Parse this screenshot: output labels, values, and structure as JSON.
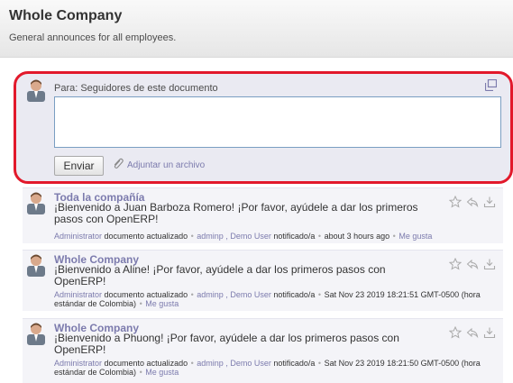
{
  "header": {
    "title": "Whole Company",
    "description": "General announces for all employees."
  },
  "composer": {
    "to_label": "Para: Seguidores de este documento",
    "message_value": "",
    "send_label": "Enviar",
    "attach_label": "Adjuntar un archivo",
    "icons": [
      "avatar",
      "expand-icon",
      "paperclip-icon"
    ]
  },
  "messages": [
    {
      "author": "Toda la compañía",
      "body": "¡Bienvenido a Juan Barboza Romero! ¡Por favor, ayúdele a dar los primeros pasos con OpenERP!",
      "meta": {
        "author": "Administrator",
        "action": "documento actualizado",
        "notified_1": "adminp",
        "notified_2": "Demo User",
        "notified_label": "notificado/a",
        "time": "about 3 hours ago",
        "like": "Me gusta"
      }
    },
    {
      "author": "Whole Company",
      "body": "¡Bienvenido a Aline! ¡Por favor, ayúdele a dar los primeros pasos con OpenERP!",
      "meta": {
        "author": "Administrator",
        "action": "documento actualizado",
        "notified_1": "adminp",
        "notified_2": "Demo User",
        "notified_label": "notificado/a",
        "time": "Sat Nov 23 2019 18:21:51 GMT-0500 (hora estándar de Colombia)",
        "like": "Me gusta"
      }
    },
    {
      "author": "Whole Company",
      "body": "¡Bienvenido a Phuong! ¡Por favor, ayúdele a dar los primeros pasos con OpenERP!",
      "meta": {
        "author": "Administrator",
        "action": "documento actualizado",
        "notified_1": "adminp",
        "notified_2": "Demo User",
        "notified_label": "notificado/a",
        "time": "Sat Nov 23 2019 18:21:50 GMT-0500 (hora estándar de Colombia)",
        "like": "Me gusta"
      }
    }
  ],
  "colors": {
    "link": "#7c7bad",
    "highlight_border": "#e2192b",
    "composer_bg": "#eaeaf2"
  }
}
